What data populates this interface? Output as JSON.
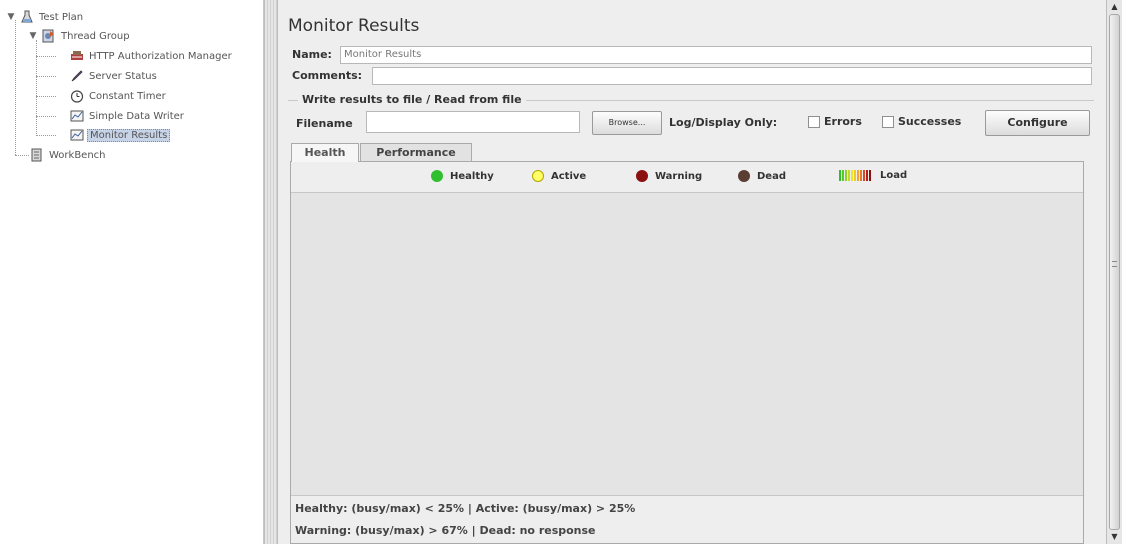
{
  "tree": {
    "items": [
      {
        "label": "Test Plan",
        "icon": "test-plan-icon"
      },
      {
        "label": "Thread Group",
        "icon": "thread-group-icon"
      },
      {
        "label": "HTTP Authorization Manager",
        "icon": "authorization-manager-icon"
      },
      {
        "label": "Server Status",
        "icon": "sampler-pencil-icon"
      },
      {
        "label": "Constant Timer",
        "icon": "timer-icon"
      },
      {
        "label": "Simple Data Writer",
        "icon": "listener-icon"
      },
      {
        "label": "Monitor Results",
        "icon": "listener-icon"
      },
      {
        "label": "WorkBench",
        "icon": "workbench-icon"
      }
    ],
    "selected": "Monitor Results"
  },
  "panel": {
    "title": "Monitor Results",
    "name_label": "Name:",
    "name_value": "Monitor Results",
    "comments_label": "Comments:",
    "comments_value": "",
    "file_group_label": "Write results to file / Read from file",
    "filename_label": "Filename",
    "filename_value": "",
    "browse_label": "Browse...",
    "log_display_label": "Log/Display Only:",
    "errors_label": "Errors",
    "successes_label": "Successes",
    "configure_label": "Configure"
  },
  "tabs": [
    {
      "label": "Health",
      "active": true
    },
    {
      "label": "Performance",
      "active": false
    }
  ],
  "legend": {
    "healthy": {
      "label": "Healthy",
      "color": "#2fbf2f"
    },
    "active": {
      "label": "Active",
      "color": "#ffff66"
    },
    "warning": {
      "label": "Warning",
      "color": "#8b1010"
    },
    "dead": {
      "label": "Dead",
      "color": "#5a3e34"
    },
    "load": {
      "label": "Load",
      "colors": [
        "#2fbf2f",
        "#58c92a",
        "#8fd12a",
        "#c5d824",
        "#ece42a",
        "#f4c62a",
        "#f0a52a",
        "#e77a2a",
        "#d24a26",
        "#b41e1e",
        "#8b1010"
      ]
    }
  },
  "status": {
    "line1": "Healthy:  (busy/max) < 25%   |   Active:  (busy/max) > 25%",
    "line2": "Warning:  (busy/max) > 67%   |   Dead:  no response"
  },
  "colors": {
    "selection": "#c7d3e6",
    "panel_bg": "#eeeeee"
  }
}
